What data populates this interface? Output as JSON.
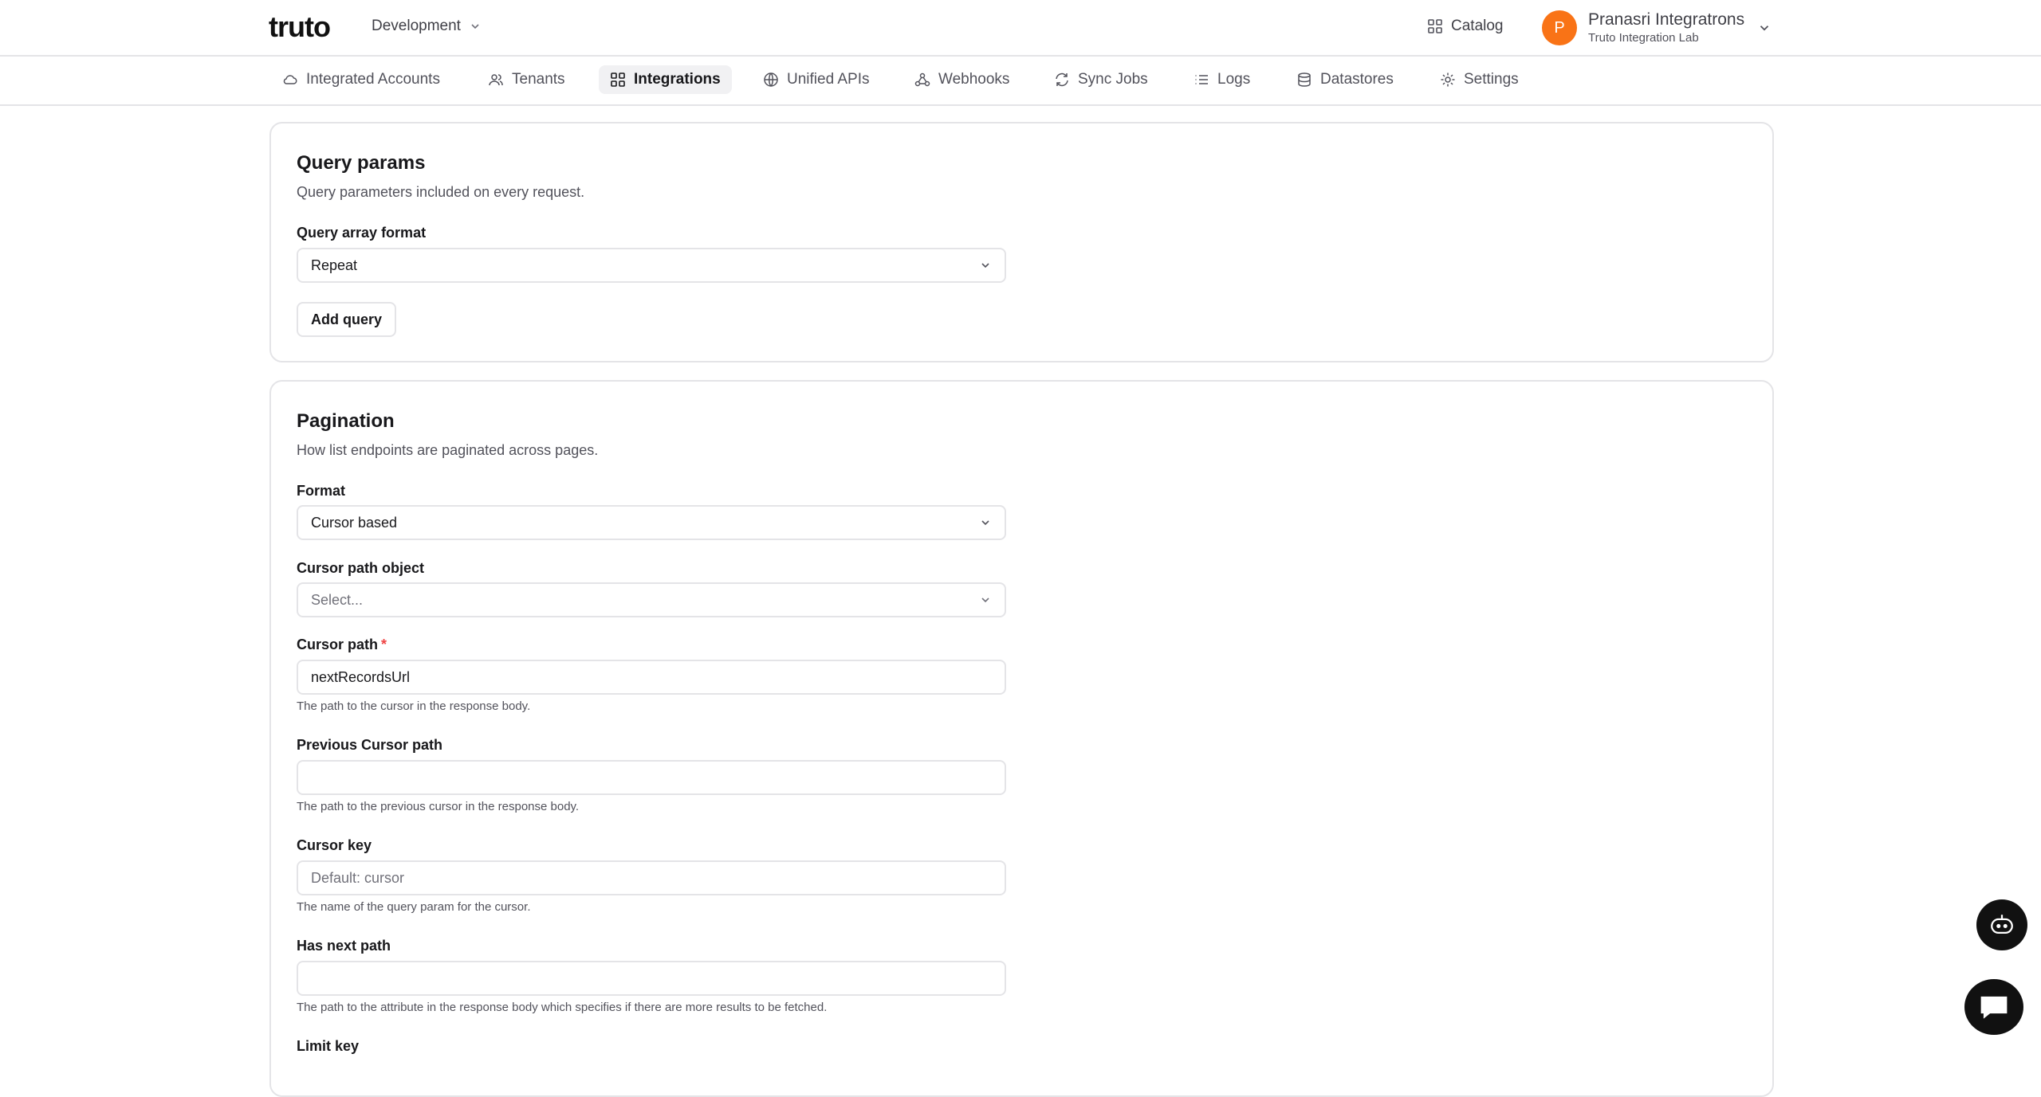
{
  "header": {
    "logo_text": "truto",
    "environment": "Development",
    "catalog_label": "Catalog",
    "user": {
      "initial": "P",
      "name": "Pranasri Integratrons",
      "org": "Truto Integration Lab"
    }
  },
  "nav": {
    "items": [
      {
        "label": "Integrated Accounts",
        "icon": "cloud-icon"
      },
      {
        "label": "Tenants",
        "icon": "users-icon"
      },
      {
        "label": "Integrations",
        "icon": "grid-icon",
        "active": true
      },
      {
        "label": "Unified APIs",
        "icon": "globe-icon"
      },
      {
        "label": "Webhooks",
        "icon": "webhook-icon"
      },
      {
        "label": "Sync Jobs",
        "icon": "sync-icon"
      },
      {
        "label": "Logs",
        "icon": "list-icon"
      },
      {
        "label": "Datastores",
        "icon": "database-icon"
      },
      {
        "label": "Settings",
        "icon": "gear-icon"
      }
    ]
  },
  "query_params": {
    "title": "Query params",
    "description": "Query parameters included on every request.",
    "array_format_label": "Query array format",
    "array_format_value": "Repeat",
    "add_query_label": "Add query"
  },
  "pagination": {
    "title": "Pagination",
    "description": "How list endpoints are paginated across pages.",
    "format_label": "Format",
    "format_value": "Cursor based",
    "cursor_path_object_label": "Cursor path object",
    "cursor_path_object_placeholder": "Select...",
    "cursor_path_label": "Cursor path",
    "cursor_path_required": "*",
    "cursor_path_value": "nextRecordsUrl",
    "cursor_path_hint": "The path to the cursor in the response body.",
    "prev_cursor_path_label": "Previous Cursor path",
    "prev_cursor_path_value": "",
    "prev_cursor_path_hint": "The path to the previous cursor in the response body.",
    "cursor_key_label": "Cursor key",
    "cursor_key_placeholder": "Default: cursor",
    "cursor_key_hint": "The name of the query param for the cursor.",
    "has_next_path_label": "Has next path",
    "has_next_path_value": "",
    "has_next_path_hint": "The path to the attribute in the response body which specifies if there are more results to be fetched.",
    "limit_key_label": "Limit key"
  },
  "colors": {
    "accent": "#f97316",
    "required": "#ef4444",
    "border": "#e4e4e7"
  }
}
